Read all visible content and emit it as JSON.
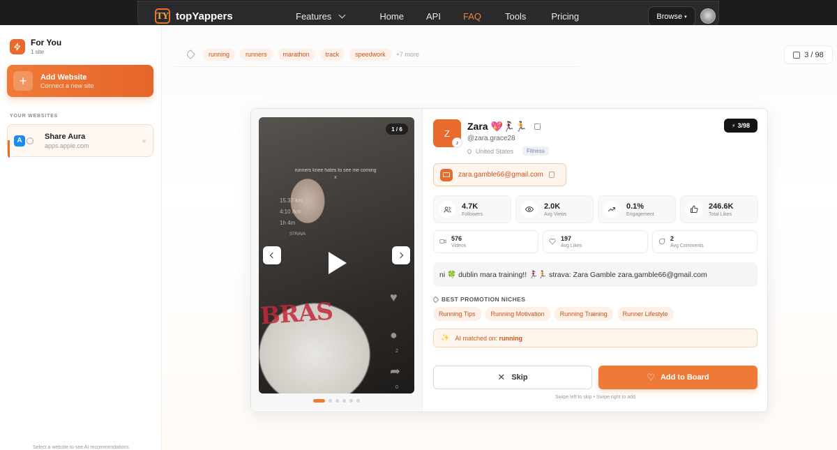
{
  "nav": {
    "brand_logo": "TY",
    "brand_name": "topYappers",
    "links": [
      "Features",
      "Home",
      "API",
      "FAQ",
      "Tools",
      "Pricing"
    ],
    "active_link": "FAQ",
    "browse_label": "Browse",
    "browse_caret": "▾"
  },
  "sidebar": {
    "foryou_title": "For You",
    "foryou_sub": "1 site",
    "add_plus": "+",
    "add_title": "Add Website",
    "add_sub": "Connect a new site",
    "section_label": "YOUR WEBSITES",
    "site_icon": "A",
    "site_name": "Share Aura",
    "site_url": "apps.apple.com",
    "footer": "Select a website to see AI recommendations"
  },
  "main": {
    "tags": [
      "running",
      "runners",
      "marathon",
      "track",
      "speedwork"
    ],
    "tags_more": "+7 more",
    "counter": "3 / 98"
  },
  "video": {
    "counter": "1 / 6",
    "caption": "runners knee hates to see me coming x",
    "overlay_stats": [
      "15.37 km",
      "4:10 /km",
      "1h 4m"
    ],
    "overlay_app": "STRAVA",
    "sweater_text": "BRAS",
    "side_counts": [
      "2",
      "0"
    ],
    "slides_total": 6,
    "slide_active": 1
  },
  "profile": {
    "avatar_letter": "Z",
    "platform_badge": "♪",
    "name": "Zara 💖🏃‍♀️🏃",
    "handle": "@zara.grace28",
    "location": "United States",
    "niche": "Fitness",
    "rank": "3/98",
    "rank_icon": "⚡",
    "email": "zara.gamble66@gmail.com"
  },
  "stats_main": [
    {
      "icon": "users-icon",
      "glyph": "👥",
      "value": "4.7K",
      "label": "Followers"
    },
    {
      "icon": "eye-icon",
      "glyph": "👁",
      "value": "2.0K",
      "label": "Avg Views"
    },
    {
      "icon": "trend-icon",
      "glyph": "↗",
      "value": "0.1%",
      "label": "Engagement"
    },
    {
      "icon": "thumb-icon",
      "glyph": "👍",
      "value": "246.6K",
      "label": "Total Likes"
    }
  ],
  "stats_secondary": [
    {
      "icon": "video-icon",
      "glyph": "▭",
      "value": "576",
      "label": "Videos"
    },
    {
      "icon": "heart-icon",
      "glyph": "♡",
      "value": "197",
      "label": "Avg Likes"
    },
    {
      "icon": "comment-icon",
      "glyph": "◯",
      "value": "2",
      "label": "Avg Comments"
    }
  ],
  "bio": "ni 🍀 dublin mara training!! 🏃‍♀️🏃 strava: Zara Gamble zara.gamble66@gmail.com",
  "promotion": {
    "title": "BEST PROMOTION NICHES",
    "niches": [
      "Running Tips",
      "Running Motivation",
      "Running Training",
      "Runner Lifestyle"
    ]
  },
  "ai_match": {
    "prefix": "AI matched on:",
    "value": "running",
    "glyph": "✨"
  },
  "actions": {
    "skip_label": "Skip",
    "skip_glyph": "✕",
    "add_label": "Add to Board",
    "add_glyph": "♡",
    "hint": "Swipe left to skip • Swipe right to add"
  },
  "colors": {
    "accent": "#EF7A37",
    "dark": "#1C1C1E",
    "chip_bg": "#FDF1EA"
  }
}
